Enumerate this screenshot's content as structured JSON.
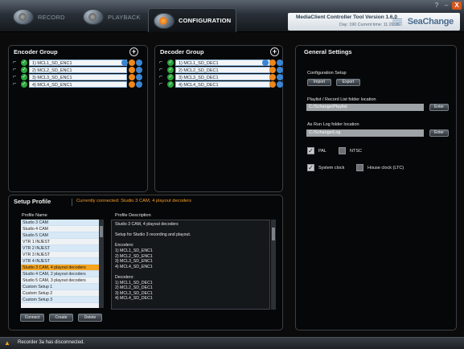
{
  "tabs": [
    {
      "label": "RECORD"
    },
    {
      "label": "PLAYBACK"
    },
    {
      "label": "CONFIGURATION"
    }
  ],
  "app": {
    "title": "MediaClient Controller Tool Version 1.6.0",
    "day": "Day: 190   Current time: 11:20:35",
    "brand": "SeaChange"
  },
  "window": {
    "help": "?",
    "minimize": "–",
    "close": "X"
  },
  "encoder_group": {
    "title": "Encoder Group",
    "items": [
      {
        "label": "1) MCL1_SD_ENC1"
      },
      {
        "label": "2) MCL2_SD_ENC1"
      },
      {
        "label": "3) MCL3_SD_ENC1"
      },
      {
        "label": "4) MCL4_SD_ENC1"
      }
    ]
  },
  "decoder_group": {
    "title": "Decoder Group",
    "items": [
      {
        "label": "1) MCL1_SD_DEC1"
      },
      {
        "label": "2) MCL2_SD_DEC1"
      },
      {
        "label": "3) MCL3_SD_DEC1"
      },
      {
        "label": "4) MCL4_SD_DEC1"
      }
    ]
  },
  "general_settings": {
    "title": "General Settings",
    "config_setup_label": "Configuration Setup",
    "import_label": "Import",
    "export_label": "Export",
    "playlist_label": "Playlist / Record List  folder location",
    "playlist_value": "C:/Schange/Playlist",
    "enter_label": "Enter",
    "asrun_label": "As Run Log folder location",
    "asrun_value": "C:/Schange/Log",
    "pal_label": "PAL",
    "ntsc_label": "NTSC",
    "system_clock_label": "System clock",
    "house_clock_label": "House clock (LTC)",
    "pal_checked": true,
    "ntsc_checked": false,
    "system_clock_checked": true,
    "house_clock_checked": false
  },
  "setup_profile": {
    "title": "Setup Profile",
    "connected": "Currently connected: Studio 3 CAM, 4 playout decoders",
    "col_name": "Profile Name",
    "col_desc": "Profile Description",
    "profiles": [
      "Studio 3 CAM",
      "Studio 4 CAM",
      "Studio 5 CAM",
      "VTR 1 INJEST",
      "VTR 2 INJEST",
      "VTR 3 INJEST",
      "VTR 4 INJEST",
      "Studio 3 CAM, 4 playout decoders",
      "Studio 4 CAM, 2 playout decoders",
      "Studio 5 CAM, 3 playout decoders",
      "Custom Setup 1",
      "Custom Setup 2",
      "Custom Setup 3"
    ],
    "selected_index": 7,
    "description_lines": [
      "Studio 3 CAM, 4 playout decoders",
      "",
      "Setup for Studio 3 recording and playout.",
      "",
      "Encoders:",
      "1) MCL1_SD_ENC1",
      "2) MCL2_SD_ENC1",
      "3) MCL3_SD_ENC1",
      "4) MCL4_SD_ENC1",
      "",
      "Decoders:",
      "1) MCL1_SD_DEC1",
      "2) MCL2_SD_DEC1",
      "3) MCL3_SD_DEC1",
      "4) MCL4_SD_DEC1"
    ],
    "connect_label": "Connect",
    "create_label": "Create",
    "delete_label": "Delete"
  },
  "status": {
    "text": "Recorder 3a has disconnected."
  }
}
